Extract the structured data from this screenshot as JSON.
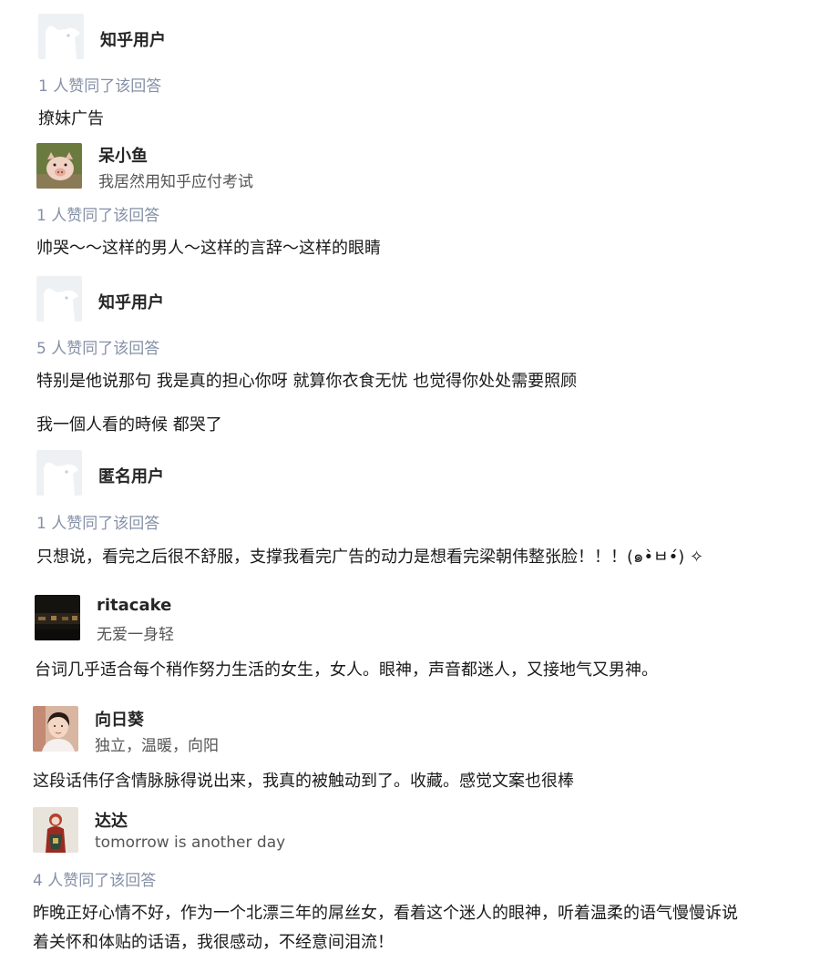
{
  "answers": [
    {
      "author": "知乎用户",
      "bio": "",
      "avatar": "default-avatar",
      "votes": "1 人赞同了该回答",
      "content": [
        "撩妹广告"
      ]
    },
    {
      "author": "呆小鱼",
      "bio": "我居然用知乎应付考试",
      "avatar": "piglet-photo-avatar",
      "votes": "1 人赞同了该回答",
      "content": [
        "帅哭～～这样的男人～这样的言辞～这样的眼睛"
      ]
    },
    {
      "author": "知乎用户",
      "bio": "",
      "avatar": "default-avatar",
      "votes": "5 人赞同了该回答",
      "content": [
        "特别是他说那句 我是真的担心你呀 就算你衣食无忧 也觉得你处处需要照顾",
        "我一個人看的時候 都哭了"
      ]
    },
    {
      "author": "匿名用户",
      "bio": "",
      "avatar": "default-avatar",
      "votes": "1 人赞同了该回答",
      "content": [
        "只想说，看完之后很不舒服，支撑我看完广告的动力是想看完梁朝伟整张脸！！！(๑•̀ㅂ•́) ✧"
      ]
    },
    {
      "author": "ritacake",
      "bio": "无爱一身轻",
      "avatar": "dark-room-photo-avatar",
      "votes": "",
      "content": [
        "台词几乎适合每个稍作努力生活的女生，女人。眼神，声音都迷人，又接地气又男神。"
      ]
    },
    {
      "author": "向日葵",
      "bio": "独立，温暖，向阳",
      "avatar": "woman-portrait-avatar",
      "votes": "",
      "content": [
        "这段话伟仔含情脉脉得说出来，我真的被触动到了。收藏。感觉文案也很棒"
      ]
    },
    {
      "author": "达达",
      "bio": "tomorrow is another day",
      "avatar": "figure-portrait-avatar",
      "votes": "4 人赞同了该回答",
      "content": [
        "昨晚正好心情不好，作为一个北漂三年的屌丝女，看着这个迷人的眼神，听着温柔的语气慢慢诉说",
        "着关怀和体贴的话语，我很感动，不经意间泪流！"
      ]
    }
  ]
}
